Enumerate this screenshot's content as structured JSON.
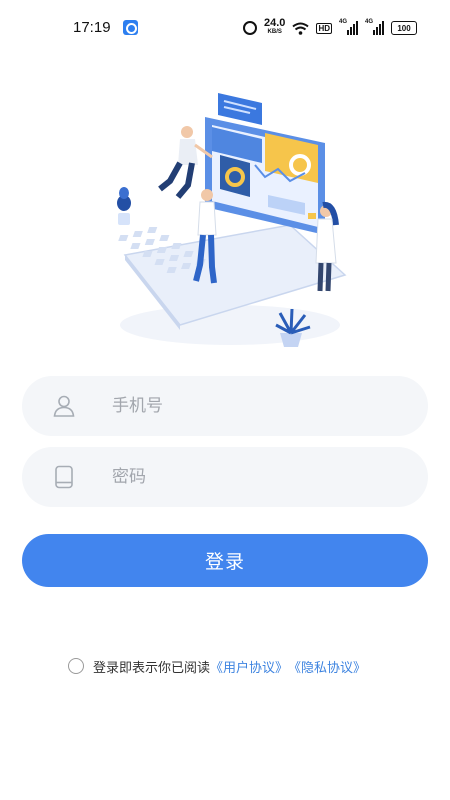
{
  "status_bar": {
    "time": "17:19",
    "net_speed": "24.0",
    "net_unit": "KB/S",
    "hd": "HD",
    "signal1": "4G",
    "signal2": "4G",
    "battery": "100"
  },
  "login": {
    "phone_placeholder": "手机号",
    "password_placeholder": "密码",
    "login_button": "登录",
    "agreement_text": "登录即表示你已阅读",
    "user_agreement": "《用户协议》",
    "privacy_agreement": "《隐私协议》"
  },
  "icons": {
    "phone_field": "person-icon",
    "password_field": "mobile-phone-icon"
  },
  "colors": {
    "primary": "#4285ee",
    "link": "#3e84e0",
    "field_bg": "#f4f6f9",
    "placeholder": "#a2a6ad"
  }
}
